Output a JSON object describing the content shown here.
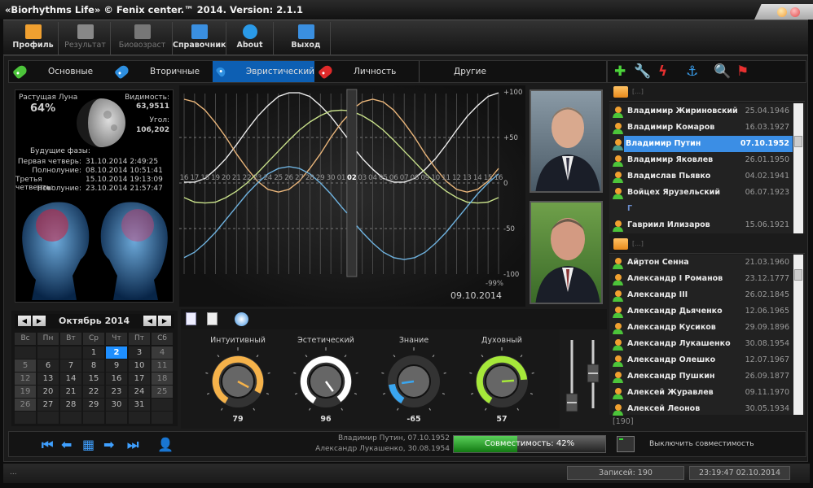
{
  "window": {
    "title": "«Biorhythms Life» © Fenix center.™ 2014. Version: 2.1.1"
  },
  "toolbar": [
    {
      "label": "Профиль",
      "icon": "folder-icon",
      "enabled": true
    },
    {
      "label": "Результат",
      "icon": "bar-chart-icon",
      "enabled": false
    },
    {
      "label": "Биовозраст",
      "icon": "heart-icon",
      "enabled": false
    },
    {
      "label": "Справочник",
      "icon": "notebook-icon",
      "enabled": true
    },
    {
      "label": "About",
      "icon": "info-icon",
      "enabled": true
    },
    {
      "label": "Выход",
      "icon": "exit-door-icon",
      "enabled": true
    }
  ],
  "tabs": [
    {
      "label": "Основные",
      "tag_color": "#4cc43a",
      "active": false
    },
    {
      "label": "Вторичные",
      "tag_color": "#2e8fe0",
      "active": false
    },
    {
      "label": "Эвристический",
      "tag_color": "#2e8fe0",
      "active": true
    },
    {
      "label": "Личность",
      "tag_color": "#e02a2a",
      "active": false
    },
    {
      "label": "Другие",
      "active": false
    }
  ],
  "list_toolbar_icons": [
    "add-icon",
    "wrench-icon",
    "lightning-icon",
    "anchor-icon",
    "magnifier-icon",
    "flag-icon"
  ],
  "moon": {
    "phase_label": "Растущая Луна",
    "phase_percent": "64%",
    "visibility_label": "Видимость:",
    "visibility": "63,9511",
    "angle_label": "Угол:",
    "angle": "106,202",
    "future_label": "Будущие фазы:",
    "phases": [
      {
        "label": "Первая четверь:",
        "value": "31.10.2014 2:49:25"
      },
      {
        "label": "Полнолуние:",
        "value": "08.10.2014 10:51:41"
      },
      {
        "label": "Третья четверть:",
        "value": "15.10.2014 19:13:09"
      },
      {
        "label": "Новолуние:",
        "value": "23.10.2014 21:57:47"
      }
    ]
  },
  "calendar": {
    "title": "Октябрь 2014",
    "weekdays": [
      "Вс",
      "Пн",
      "Вт",
      "Ср",
      "Чт",
      "Пт",
      "Сб"
    ],
    "weeks": [
      [
        "",
        "",
        "",
        "1",
        "2",
        "3",
        "4"
      ],
      [
        "5",
        "6",
        "7",
        "8",
        "9",
        "10",
        "11"
      ],
      [
        "12",
        "13",
        "14",
        "15",
        "16",
        "17",
        "18"
      ],
      [
        "19",
        "20",
        "21",
        "22",
        "23",
        "24",
        "25"
      ],
      [
        "26",
        "27",
        "28",
        "29",
        "30",
        "31",
        ""
      ],
      [
        "",
        "",
        "",
        "",
        "",
        "",
        ""
      ]
    ],
    "selected": "2"
  },
  "chart_data": {
    "type": "line",
    "x": [
      "16",
      "17",
      "18",
      "19",
      "20",
      "21",
      "22",
      "23",
      "24",
      "25",
      "26",
      "27",
      "28",
      "29",
      "30",
      "01",
      "02",
      "03",
      "04",
      "05",
      "06",
      "07",
      "08",
      "09",
      "10",
      "11",
      "12",
      "13",
      "14",
      "15",
      "16"
    ],
    "current_x": "02",
    "ylim": [
      -100,
      100
    ],
    "yticks": [
      "+100",
      "+50",
      "0",
      "-50",
      "-100"
    ],
    "grid": true,
    "series": [
      {
        "color": "#f0f0f0",
        "values": [
          1,
          1,
          5,
          15,
          27,
          42,
          58,
          73,
          85,
          95,
          99,
          99,
          95,
          85,
          73,
          58,
          42,
          27,
          15,
          5,
          1,
          1,
          5,
          15,
          27,
          42,
          58,
          73,
          85,
          95,
          99
        ]
      },
      {
        "color": "#e9b57a",
        "values": [
          92,
          89,
          80,
          66,
          50,
          32,
          16,
          2,
          -7,
          -10,
          -7,
          2,
          16,
          32,
          50,
          66,
          80,
          89,
          92,
          89,
          80,
          66,
          50,
          32,
          16,
          2,
          -7,
          -10,
          -7,
          2,
          16
        ]
      },
      {
        "color": "#c8e08a",
        "values": [
          -16,
          -21,
          -22,
          -21,
          -16,
          -9,
          0,
          11,
          23,
          35,
          47,
          58,
          67,
          74,
          79,
          80,
          79,
          74,
          67,
          58,
          47,
          35,
          23,
          11,
          0,
          -9,
          -16,
          -21,
          -22,
          -21,
          -16
        ]
      },
      {
        "color": "#6fb3e0",
        "values": [
          -82,
          -76,
          -66,
          -54,
          -40,
          -26,
          -12,
          0,
          10,
          16,
          18,
          16,
          10,
          0,
          -12,
          -26,
          -40,
          -54,
          -66,
          -76,
          -82,
          -84,
          -82,
          -76,
          -66,
          -54,
          -40,
          -26,
          -12,
          0,
          10
        ]
      }
    ],
    "annotations": {
      "percent": "-99%",
      "date": "09.10.2014"
    }
  },
  "list1": {
    "folder": "[...]",
    "items": [
      {
        "name": "Владимир Жириновский",
        "date": "25.04.1946"
      },
      {
        "name": "Владимир Комаров",
        "date": "16.03.1927"
      },
      {
        "name": "Владимир Путин",
        "date": "07.10.1952",
        "selected": true
      },
      {
        "name": "Владимир Яковлев",
        "date": "26.01.1950"
      },
      {
        "name": "Владислав Пьявко",
        "date": "04.02.1941"
      },
      {
        "name": "Войцех Ярузельский",
        "date": "06.07.1923"
      },
      {
        "letter": "Г"
      },
      {
        "name": "Гавриил Илизаров",
        "date": "15.06.1921"
      }
    ]
  },
  "list2": {
    "folder": "[...]",
    "items": [
      {
        "name": "Айртон Сенна",
        "date": "21.03.1960"
      },
      {
        "name": "Александр I Романов",
        "date": "23.12.1777"
      },
      {
        "name": "Александр III",
        "date": "26.02.1845"
      },
      {
        "name": "Александр Дьяченко",
        "date": "12.06.1965"
      },
      {
        "name": "Александр Кусиков",
        "date": "29.09.1896"
      },
      {
        "name": "Александр Лукашенко",
        "date": "30.08.1954"
      },
      {
        "name": "Александр Олешко",
        "date": "12.07.1967"
      },
      {
        "name": "Александр Пушкин",
        "date": "26.09.1877"
      },
      {
        "name": "Алексей Журавлев",
        "date": "09.11.1970"
      },
      {
        "name": "Алексей Леонов",
        "date": "30.05.1934"
      }
    ],
    "count": "[190]"
  },
  "knobs": [
    {
      "label": "Интуитивный",
      "value": 79,
      "display": "79",
      "color": "#f5b24a"
    },
    {
      "label": "Эстетический",
      "value": 96,
      "display": "96",
      "color": "#ffffff"
    },
    {
      "label": "Знание",
      "value": -65,
      "display": "-65",
      "color": "#3aa6f0"
    },
    {
      "label": "Духовный",
      "value": 57,
      "display": "57",
      "color": "#a6e83a"
    }
  ],
  "sliders": [
    {
      "level": 0.15
    },
    {
      "level": 0.6
    }
  ],
  "compat": {
    "person1": "Владимир Путин, 07.10.1952",
    "person2": "Александр Лукашенко, 30.08.1954",
    "label": "Совместимость: 42%",
    "percent": 42,
    "toggle_label": "Выключить совместимость"
  },
  "status": {
    "left": "...",
    "records": "Записей: 190",
    "datetime": "23:19:47 02.10.2014"
  }
}
